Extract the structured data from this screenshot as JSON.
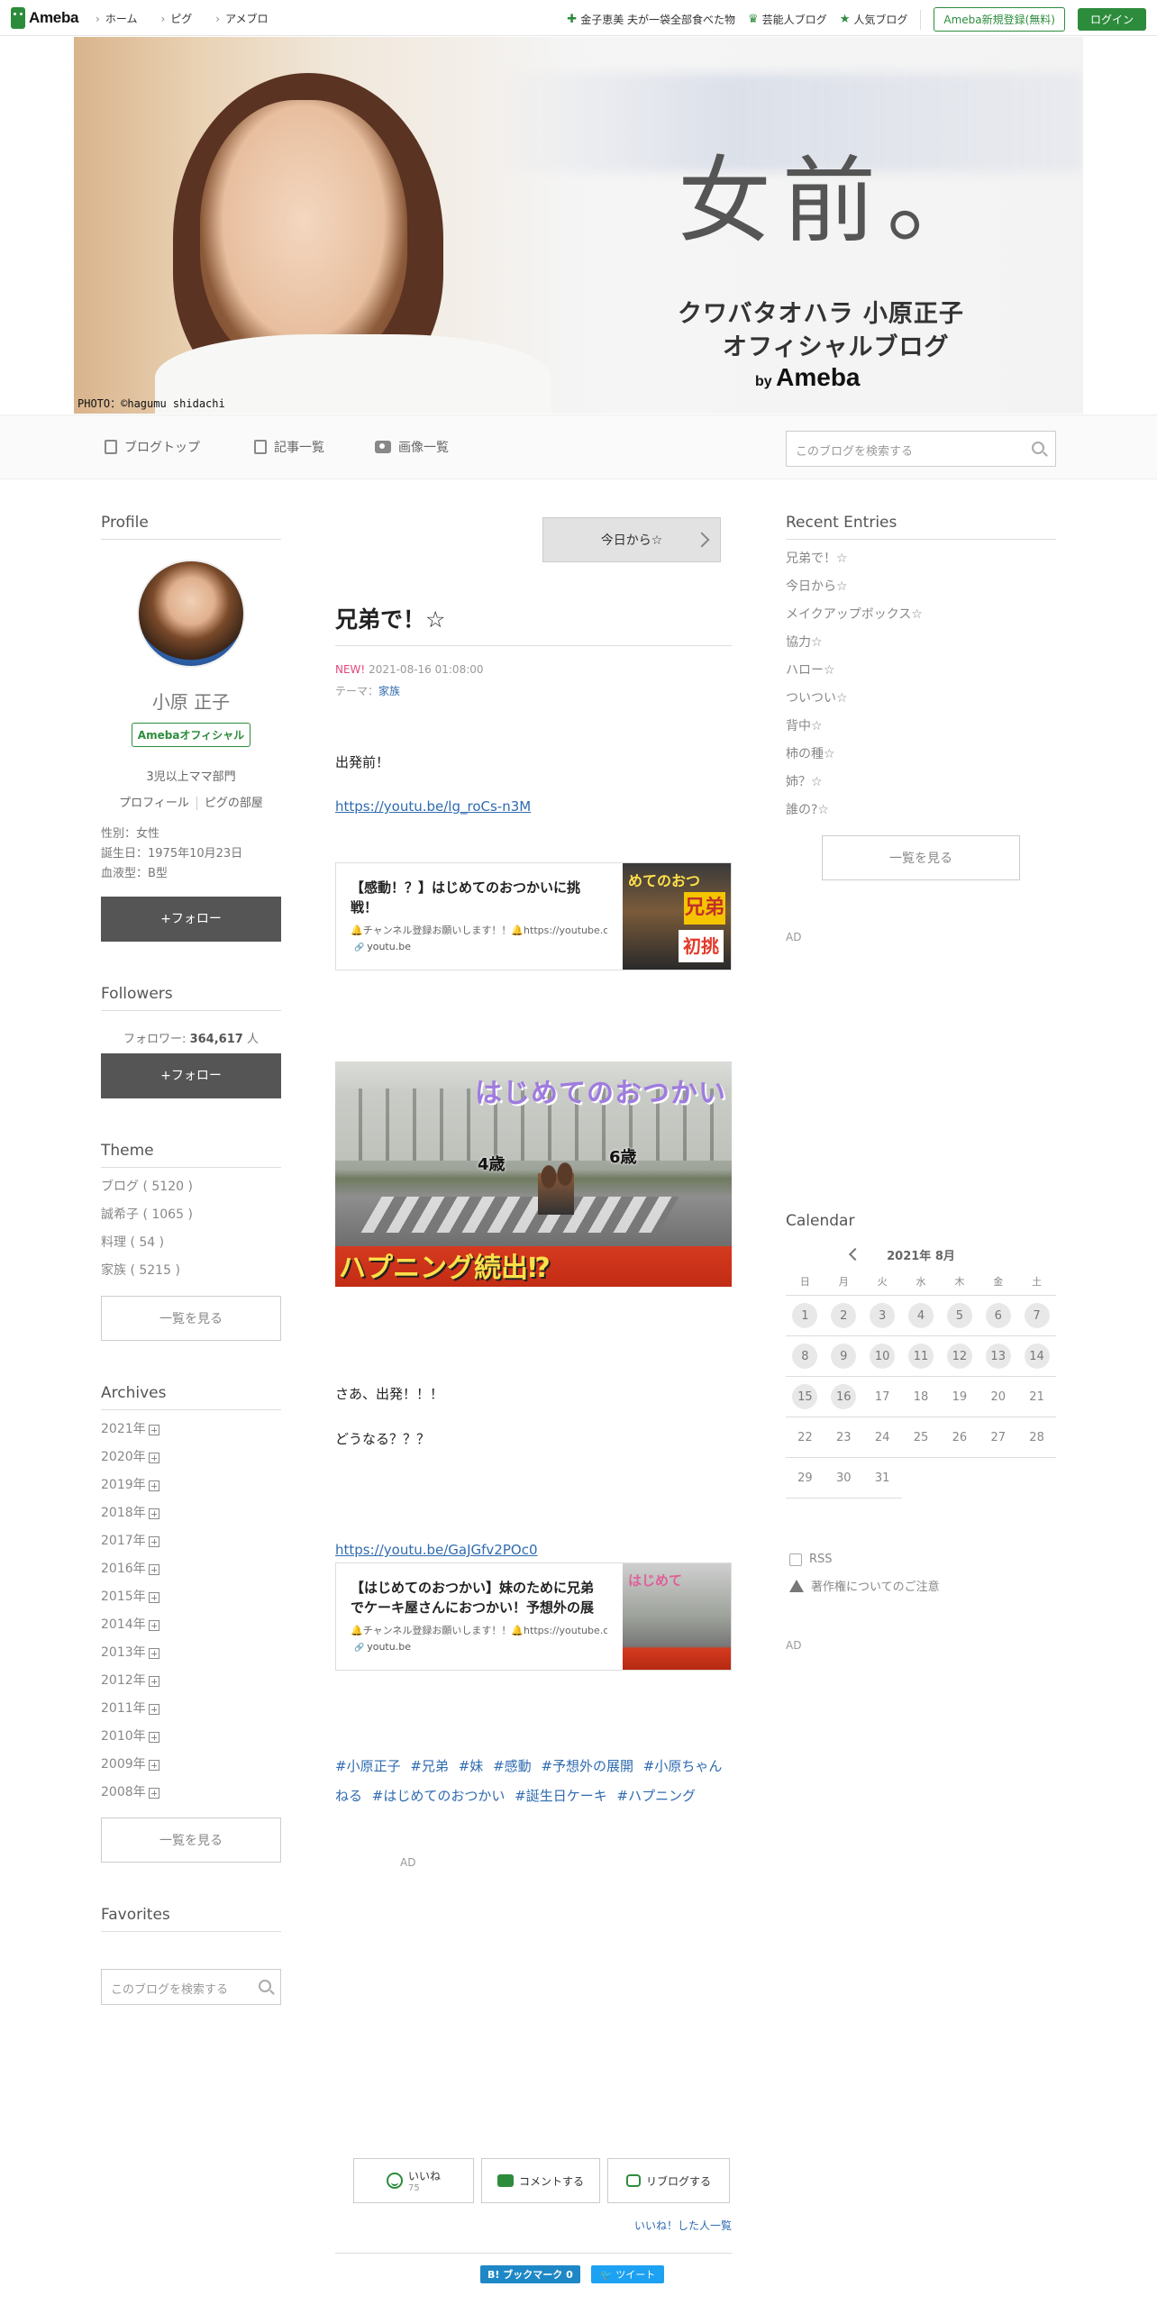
{
  "topnav": {
    "logo": "Ameba",
    "links": [
      "ホーム",
      "ピグ",
      "アメブロ"
    ],
    "right_links": [
      "金子恵美 夫が一袋全部食べた物",
      "芸能人ブログ",
      "人気ブログ"
    ],
    "register": "Ameba新規登録(無料)",
    "login": "ログイン"
  },
  "banner": {
    "title": "女前。",
    "sub1": "クワバタオハラ 小原正子",
    "sub2": "オフィシャルブログ",
    "by": "by",
    "brand": "Ameba",
    "credit": "PHOTO：©hagumu shidachi"
  },
  "blognav": {
    "items": [
      "ブログトップ",
      "記事一覧",
      "画像一覧"
    ],
    "search_placeholder": "このブログを検索する"
  },
  "profile": {
    "heading": "Profile",
    "name": "小原 正子",
    "badge": "Amebaオフィシャル",
    "desc": "3児以上ママ部門",
    "link1": "プロフィール",
    "link2": "ピグの部屋",
    "gender": "性別：女性",
    "birthday": "誕生日：1975年10月23日",
    "blood": "血液型：B型",
    "follow": "+フォロー"
  },
  "followers": {
    "heading": "Followers",
    "label": "フォロワー:",
    "count": "364,617",
    "unit": "人",
    "follow": "+フォロー"
  },
  "theme": {
    "heading": "Theme",
    "items": [
      "ブログ ( 5120 )",
      "誠希子 ( 1065 )",
      "料理 ( 54 )",
      "家族 ( 5215 )"
    ],
    "more": "一覧を見る"
  },
  "archives": {
    "heading": "Archives",
    "years": [
      "2021年",
      "2020年",
      "2019年",
      "2018年",
      "2017年",
      "2016年",
      "2015年",
      "2014年",
      "2013年",
      "2012年",
      "2011年",
      "2010年",
      "2009年",
      "2008年"
    ],
    "more": "一覧を見る"
  },
  "favorites": {
    "heading": "Favorites",
    "search_placeholder": "このブログを検索する"
  },
  "article": {
    "next": "今日から☆",
    "title": "兄弟で！☆",
    "new": "NEW!",
    "date": "2021-08-16 01:08:00",
    "theme_label": "テーマ：",
    "theme": "家族",
    "p1": "出発前！",
    "link1": "https://youtu.be/lg_roCs-n3M",
    "card1": {
      "title": "【感動！？】はじめてのおつかいに挑戦！",
      "desc": "🔔チャンネル登録お願いします！！🔔https://youtube.com",
      "host": "youtu.be",
      "thumb_a": "めてのおつ",
      "thumb_b": "兄弟",
      "thumb_c": "初挑"
    },
    "image": {
      "title": "はじめてのおつかい",
      "age1": "4歳",
      "age2": "6歳",
      "band": "ハプニング続出⁉"
    },
    "p2": "さあ、出発！！！",
    "p3": "どうなる？？？",
    "link2": "https://youtu.be/GaJGfv2POc0",
    "card2": {
      "title": "【はじめてのおつかい】妹のために兄弟でケーキ屋さんにおつかい！予想外の展開",
      "desc": "🔔チャンネル登録お願いします！！🔔https://youtube.com",
      "host": "youtu.be",
      "thumb_a": "はじめて"
    },
    "tags": [
      "#小原正子",
      "#兄弟",
      "#妹",
      "#感動",
      "#予想外の展開",
      "#小原ちゃんねる",
      "#はじめてのおつかい",
      "#誕生日ケーキ",
      "#ハプニング"
    ],
    "ad": "AD"
  },
  "reactions": {
    "like": "いいね",
    "like_count": "75",
    "comment": "コメントする",
    "reblog": "リブログする",
    "liked_people": "いいね！した人一覧",
    "hatena": "B! ブックマーク",
    "hatena_count": "0",
    "tweet": "ツイート"
  },
  "recent": {
    "heading": "Recent Entries",
    "items": [
      "兄弟で！☆",
      "今日から☆",
      "メイクアップボックス☆",
      "協力☆",
      "ハロー☆",
      "ついつい☆",
      "背中☆",
      "柿の種☆",
      "姉？☆",
      "誰の?☆"
    ],
    "more": "一覧を見る",
    "ad": "AD"
  },
  "calendar": {
    "heading": "Calendar",
    "month": "2021年 8月",
    "dow": [
      "日",
      "月",
      "火",
      "水",
      "木",
      "金",
      "土"
    ],
    "days": [
      "1",
      "2",
      "3",
      "4",
      "5",
      "6",
      "7",
      "8",
      "9",
      "10",
      "11",
      "12",
      "13",
      "14",
      "15",
      "16",
      "17",
      "18",
      "19",
      "20",
      "21",
      "22",
      "23",
      "24",
      "25",
      "26",
      "27",
      "28",
      "29",
      "30",
      "31"
    ],
    "posted_until": 16
  },
  "footer_links": {
    "rss": "RSS",
    "copyright": "著作権についてのご注意",
    "ad": "AD"
  }
}
